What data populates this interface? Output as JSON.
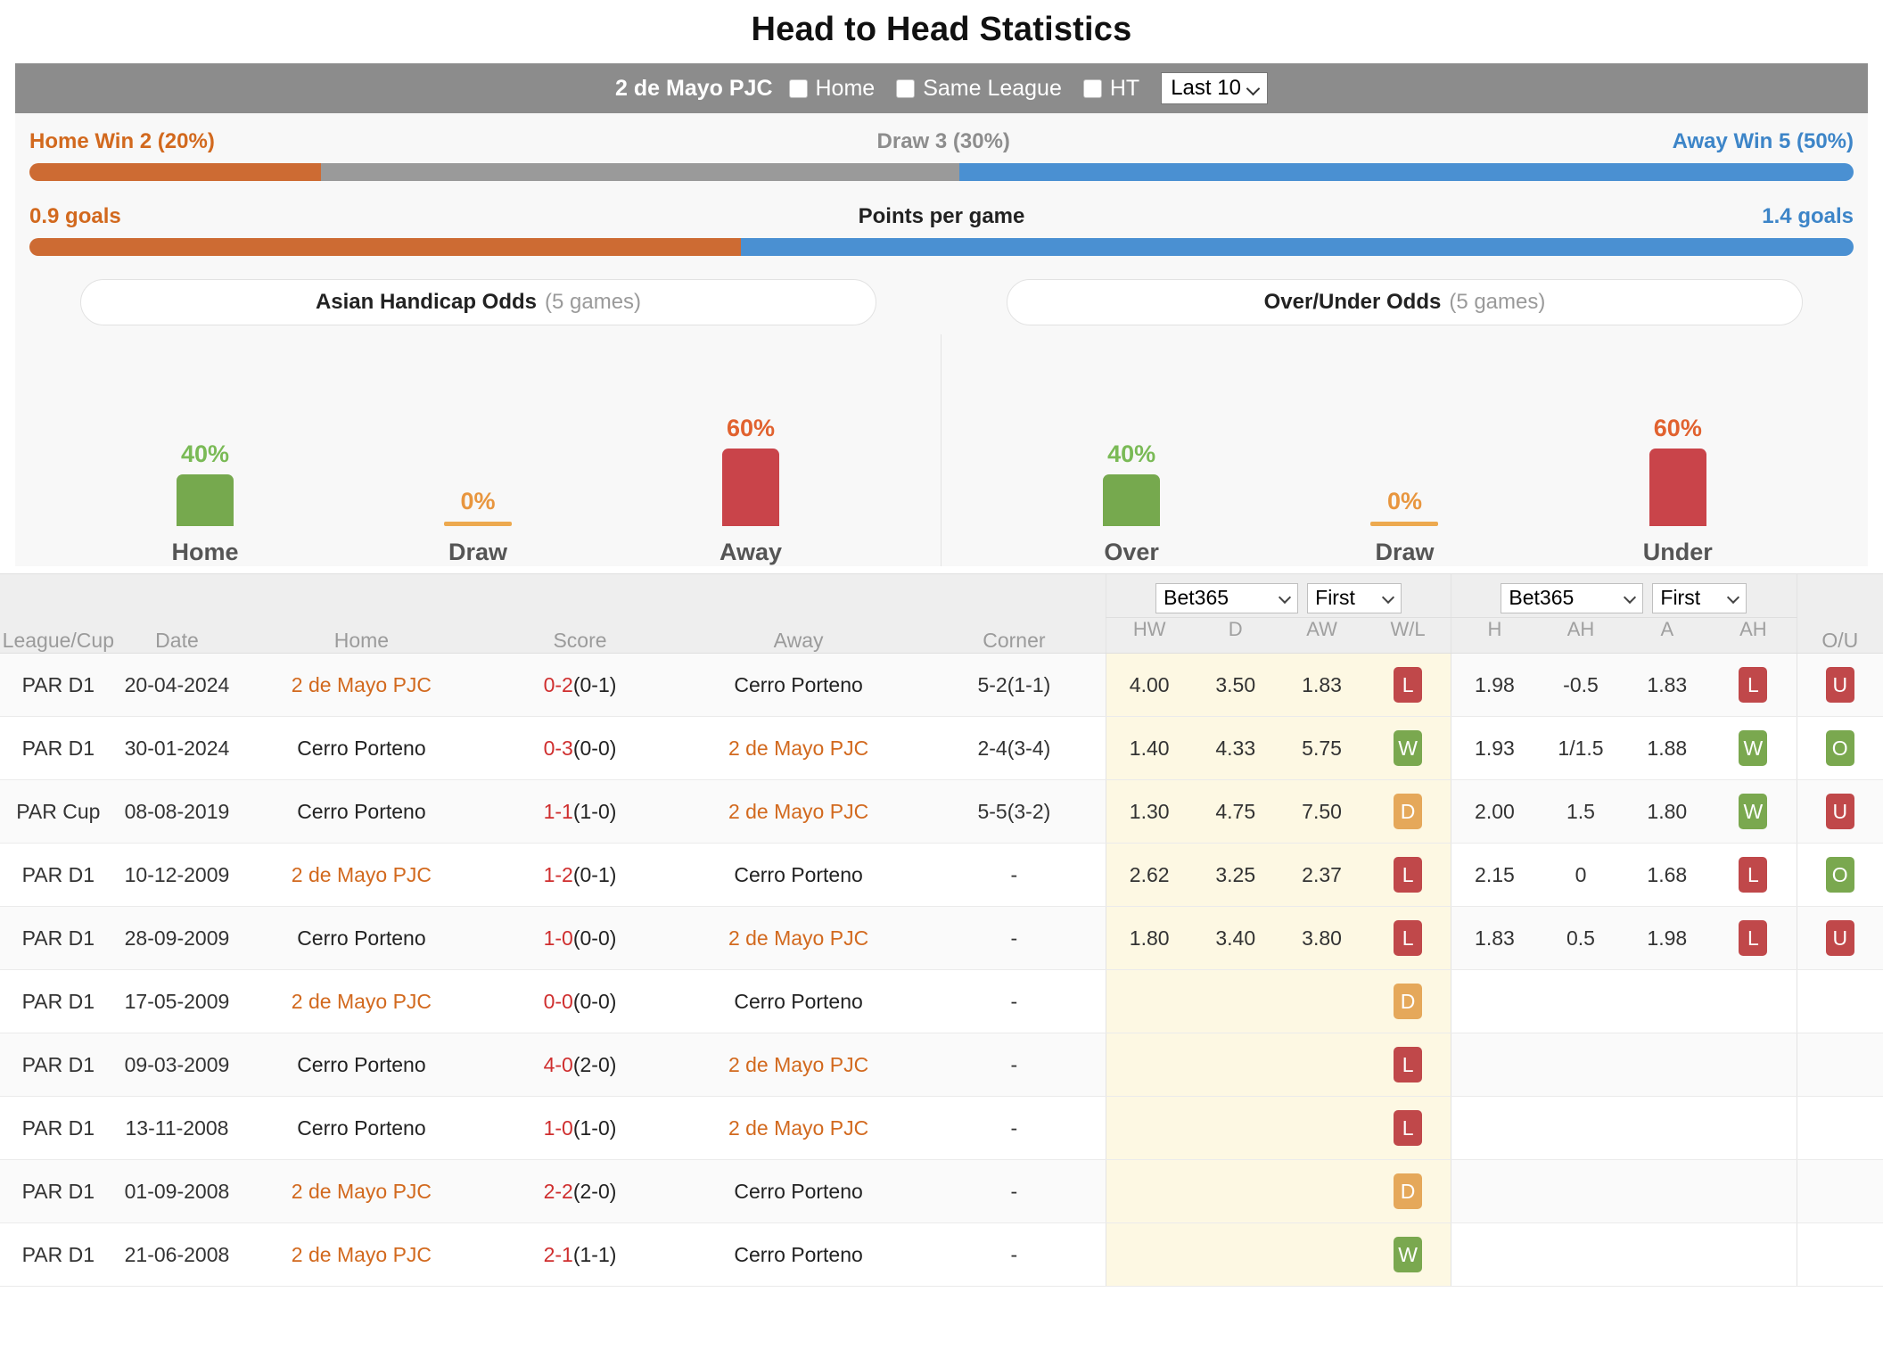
{
  "header": {
    "title": "Head to Head Statistics"
  },
  "filter_bar": {
    "team_name": "2 de Mayo PJC",
    "checkboxes": [
      {
        "label": "Home",
        "checked": false
      },
      {
        "label": "Same League",
        "checked": false
      },
      {
        "label": "HT",
        "checked": false
      }
    ],
    "range_select": {
      "value": "Last 10"
    }
  },
  "summary": {
    "result_row": {
      "home": "Home Win 2 (20%)",
      "draw": "Draw 3 (30%)",
      "away": "Away Win 5 (50%)",
      "home_pct": 16,
      "draw_pct": 35,
      "away_pct": 49
    },
    "ppg_row": {
      "home": "0.9 goals",
      "center": "Points per game",
      "away": "1.4 goals",
      "home_pct": 39,
      "away_pct": 61
    }
  },
  "pills": [
    {
      "title": "Asian Handicap Odds",
      "note": "(5 games)"
    },
    {
      "title": "Over/Under Odds",
      "note": "(5 games)"
    }
  ],
  "chart_data": [
    {
      "type": "bar",
      "title": "Asian Handicap Odds (5 games)",
      "categories": [
        "Home",
        "Draw",
        "Away"
      ],
      "values": [
        40,
        0,
        60
      ],
      "labels": [
        "40%",
        "0%",
        "60%"
      ],
      "colors": [
        "#76a94e",
        "#eda94f",
        "#c9444a"
      ],
      "label_colors": [
        "#7aba56",
        "#e8963f",
        "#e1622f"
      ],
      "ylim": [
        0,
        100
      ],
      "ylabel": "",
      "xlabel": "",
      "grid": false,
      "legend": "none"
    },
    {
      "type": "bar",
      "title": "Over/Under Odds (5 games)",
      "categories": [
        "Over",
        "Draw",
        "Under"
      ],
      "values": [
        40,
        0,
        60
      ],
      "labels": [
        "40%",
        "0%",
        "60%"
      ],
      "colors": [
        "#76a94e",
        "#eda94f",
        "#c9444a"
      ],
      "label_colors": [
        "#7aba56",
        "#e8963f",
        "#e1622f"
      ],
      "ylim": [
        0,
        100
      ],
      "ylabel": "",
      "xlabel": "",
      "grid": false,
      "legend": "none"
    }
  ],
  "table": {
    "headers": {
      "league": "League/Cup",
      "date": "Date",
      "home": "Home",
      "score": "Score",
      "away": "Away",
      "corner": "Corner",
      "ou": "O/U"
    },
    "odds_group_1x2": {
      "bookmaker": "Bet365",
      "timing": "First",
      "sub": [
        "HW",
        "D",
        "AW",
        "W/L"
      ]
    },
    "odds_group_ah": {
      "bookmaker": "Bet365",
      "timing": "First",
      "sub": [
        "H",
        "AH",
        "A",
        "AH"
      ]
    },
    "rows": [
      {
        "league": "PAR D1",
        "date": "20-04-2024",
        "home": "2 de Mayo PJC",
        "home_hl": true,
        "score_main": "0-2",
        "score_ht": "(0-1)",
        "away": "Cerro Porteno",
        "away_hl": false,
        "corner": "5-2(1-1)",
        "hw": "4.00",
        "d": "3.50",
        "aw": "1.83",
        "wl": "L",
        "h": "1.98",
        "ah": "-0.5",
        "a": "1.83",
        "ah_res": "L",
        "ou": "U"
      },
      {
        "league": "PAR D1",
        "date": "30-01-2024",
        "home": "Cerro Porteno",
        "home_hl": false,
        "score_main": "0-3",
        "score_ht": "(0-0)",
        "away": "2 de Mayo PJC",
        "away_hl": true,
        "corner": "2-4(3-4)",
        "hw": "1.40",
        "d": "4.33",
        "aw": "5.75",
        "wl": "W",
        "h": "1.93",
        "ah": "1/1.5",
        "a": "1.88",
        "ah_res": "W",
        "ou": "O"
      },
      {
        "league": "PAR Cup",
        "date": "08-08-2019",
        "home": "Cerro Porteno",
        "home_hl": false,
        "score_main": "1-1",
        "score_ht": "(1-0)",
        "away": "2 de Mayo PJC",
        "away_hl": true,
        "corner": "5-5(3-2)",
        "hw": "1.30",
        "d": "4.75",
        "aw": "7.50",
        "wl": "D",
        "h": "2.00",
        "ah": "1.5",
        "a": "1.80",
        "ah_res": "W",
        "ou": "U"
      },
      {
        "league": "PAR D1",
        "date": "10-12-2009",
        "home": "2 de Mayo PJC",
        "home_hl": true,
        "score_main": "1-2",
        "score_ht": "(0-1)",
        "away": "Cerro Porteno",
        "away_hl": false,
        "corner": "-",
        "hw": "2.62",
        "d": "3.25",
        "aw": "2.37",
        "wl": "L",
        "h": "2.15",
        "ah": "0",
        "a": "1.68",
        "ah_res": "L",
        "ou": "O"
      },
      {
        "league": "PAR D1",
        "date": "28-09-2009",
        "home": "Cerro Porteno",
        "home_hl": false,
        "score_main": "1-0",
        "score_ht": "(0-0)",
        "away": "2 de Mayo PJC",
        "away_hl": true,
        "corner": "-",
        "hw": "1.80",
        "d": "3.40",
        "aw": "3.80",
        "wl": "L",
        "h": "1.83",
        "ah": "0.5",
        "a": "1.98",
        "ah_res": "L",
        "ou": "U"
      },
      {
        "league": "PAR D1",
        "date": "17-05-2009",
        "home": "2 de Mayo PJC",
        "home_hl": true,
        "score_main": "0-0",
        "score_ht": "(0-0)",
        "away": "Cerro Porteno",
        "away_hl": false,
        "corner": "-",
        "hw": "",
        "d": "",
        "aw": "",
        "wl": "D",
        "h": "",
        "ah": "",
        "a": "",
        "ah_res": "",
        "ou": ""
      },
      {
        "league": "PAR D1",
        "date": "09-03-2009",
        "home": "Cerro Porteno",
        "home_hl": false,
        "score_main": "4-0",
        "score_ht": "(2-0)",
        "away": "2 de Mayo PJC",
        "away_hl": true,
        "corner": "-",
        "hw": "",
        "d": "",
        "aw": "",
        "wl": "L",
        "h": "",
        "ah": "",
        "a": "",
        "ah_res": "",
        "ou": ""
      },
      {
        "league": "PAR D1",
        "date": "13-11-2008",
        "home": "Cerro Porteno",
        "home_hl": false,
        "score_main": "1-0",
        "score_ht": "(1-0)",
        "away": "2 de Mayo PJC",
        "away_hl": true,
        "corner": "-",
        "hw": "",
        "d": "",
        "aw": "",
        "wl": "L",
        "h": "",
        "ah": "",
        "a": "",
        "ah_res": "",
        "ou": ""
      },
      {
        "league": "PAR D1",
        "date": "01-09-2008",
        "home": "2 de Mayo PJC",
        "home_hl": true,
        "score_main": "2-2",
        "score_ht": "(2-0)",
        "away": "Cerro Porteno",
        "away_hl": false,
        "corner": "-",
        "hw": "",
        "d": "",
        "aw": "",
        "wl": "D",
        "h": "",
        "ah": "",
        "a": "",
        "ah_res": "",
        "ou": ""
      },
      {
        "league": "PAR D1",
        "date": "21-06-2008",
        "home": "2 de Mayo PJC",
        "home_hl": true,
        "score_main": "2-1",
        "score_ht": "(1-1)",
        "away": "Cerro Porteno",
        "away_hl": false,
        "corner": "-",
        "hw": "",
        "d": "",
        "aw": "",
        "wl": "W",
        "h": "",
        "ah": "",
        "a": "",
        "ah_res": "",
        "ou": ""
      }
    ]
  },
  "colors": {
    "home_orange": "#cd6b33",
    "draw_gray": "#9a9a9a",
    "away_blue": "#4a90d2",
    "win_green": "#7aa84f",
    "lose_red": "#c0484a",
    "draw_amber": "#e5a85a",
    "filter_bar_bg": "#8c8c8c"
  }
}
